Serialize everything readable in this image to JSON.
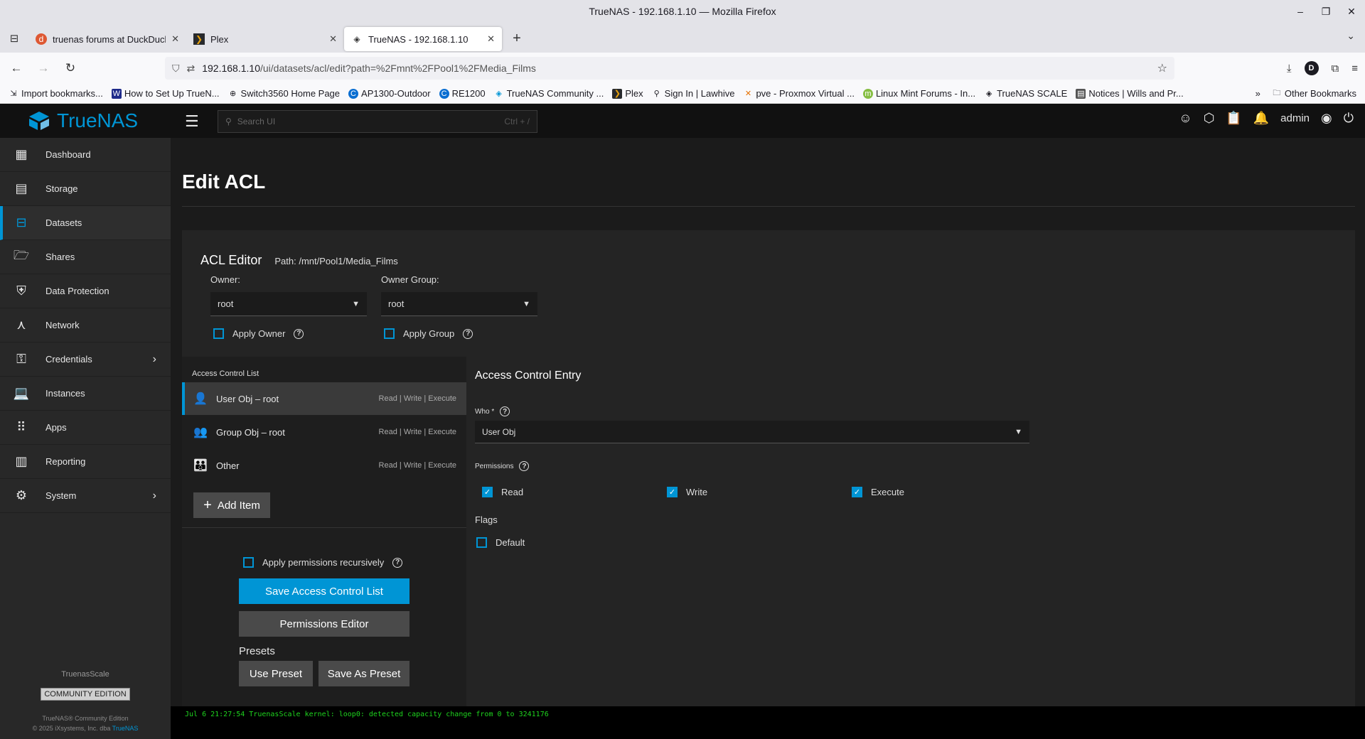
{
  "window": {
    "title": "TrueNAS - 192.168.1.10 — Mozilla Firefox"
  },
  "tabs": [
    {
      "label": "truenas forums at DuckDuckGo",
      "icon": "duckduckgo-icon"
    },
    {
      "label": "Plex",
      "icon": "plex-icon"
    },
    {
      "label": "TrueNAS - 192.168.1.10",
      "icon": "truenas-icon",
      "active": true
    }
  ],
  "urlbar": {
    "host": "192.168.1.10",
    "path": "/ui/datasets/acl/edit?path=%2Fmnt%2FPool1%2FMedia_Films"
  },
  "bookmarks": [
    {
      "label": "Import bookmarks...",
      "icon": "import-icon"
    },
    {
      "label": "How to Set Up TrueN...",
      "icon": "wordpress-icon"
    },
    {
      "label": "Switch3560 Home Page",
      "icon": "globe-icon"
    },
    {
      "label": "AP1300-Outdoor",
      "icon": "c-icon"
    },
    {
      "label": "RE1200",
      "icon": "c-icon"
    },
    {
      "label": "TrueNAS Community ...",
      "icon": "truenas-icon"
    },
    {
      "label": "Plex",
      "icon": "plex-icon"
    },
    {
      "label": "Sign In | Lawhive",
      "icon": "lawhive-icon"
    },
    {
      "label": "pve - Proxmox Virtual ...",
      "icon": "proxmox-icon"
    },
    {
      "label": "Linux Mint Forums - In...",
      "icon": "mint-icon"
    },
    {
      "label": "TrueNAS SCALE",
      "icon": "truenas-icon"
    },
    {
      "label": "Notices | Wills and Pr...",
      "icon": "page-icon"
    }
  ],
  "bookmarks_other": "Other Bookmarks",
  "app": {
    "brand": "TrueNAS",
    "search_placeholder": "Search UI",
    "search_shortcut": "Ctrl + /",
    "username": "admin"
  },
  "sidebar": {
    "items": [
      {
        "label": "Dashboard",
        "icon": "dashboard-icon"
      },
      {
        "label": "Storage",
        "icon": "storage-icon"
      },
      {
        "label": "Datasets",
        "icon": "datasets-icon",
        "active": true
      },
      {
        "label": "Shares",
        "icon": "shares-icon"
      },
      {
        "label": "Data Protection",
        "icon": "shield-icon"
      },
      {
        "label": "Network",
        "icon": "network-icon"
      },
      {
        "label": "Credentials",
        "icon": "key-icon",
        "expandable": true
      },
      {
        "label": "Instances",
        "icon": "laptop-icon"
      },
      {
        "label": "Apps",
        "icon": "apps-grid-icon"
      },
      {
        "label": "Reporting",
        "icon": "reporting-icon"
      },
      {
        "label": "System",
        "icon": "gear-icon",
        "expandable": true
      }
    ],
    "hostname": "TruenasScale",
    "edition": "COMMUNITY EDITION",
    "copyright_line1": "TrueNAS® Community Edition",
    "copyright_line2": "© 2025 iXsystems, Inc. dba ",
    "copyright_link": "TrueNAS"
  },
  "page": {
    "title": "Edit ACL",
    "editor_title": "ACL Editor",
    "path_label": "Path:  /mnt/Pool1/Media_Films",
    "owner_label": "Owner:",
    "owner_value": "root",
    "owner_group_label": "Owner Group:",
    "owner_group_value": "root",
    "apply_owner": "Apply Owner",
    "apply_group": "Apply Group",
    "acl_list_title": "Access Control List",
    "acl_items": [
      {
        "label": "User Obj – root",
        "perm": "Read | Write | Execute",
        "icon": "user-icon"
      },
      {
        "label": "Group Obj – root",
        "perm": "Read | Write | Execute",
        "icon": "group-icon"
      },
      {
        "label": "Other",
        "perm": "Read | Write | Execute",
        "icon": "people-icon"
      }
    ],
    "add_item": "Add Item",
    "apply_recursive": "Apply permissions recursively",
    "save_acl": "Save Access Control List",
    "permissions_editor": "Permissions Editor",
    "presets_label": "Presets",
    "use_preset": "Use Preset",
    "save_as_preset": "Save As Preset",
    "ace_title": "Access Control Entry",
    "who_label": "Who *",
    "who_value": "User Obj",
    "permissions_label": "Permissions",
    "perm_read": "Read",
    "perm_write": "Write",
    "perm_execute": "Execute",
    "flags_label": "Flags",
    "flag_default": "Default"
  },
  "console": {
    "text": "Jul  6 21:27:54 TruenasScale kernel: loop0: detected capacity change from 0 to 3241176"
  },
  "colors": {
    "accent": "#0095d5",
    "bg": "#1b1b1b",
    "sidebar": "#282828",
    "console_text": "#1ed41e"
  }
}
